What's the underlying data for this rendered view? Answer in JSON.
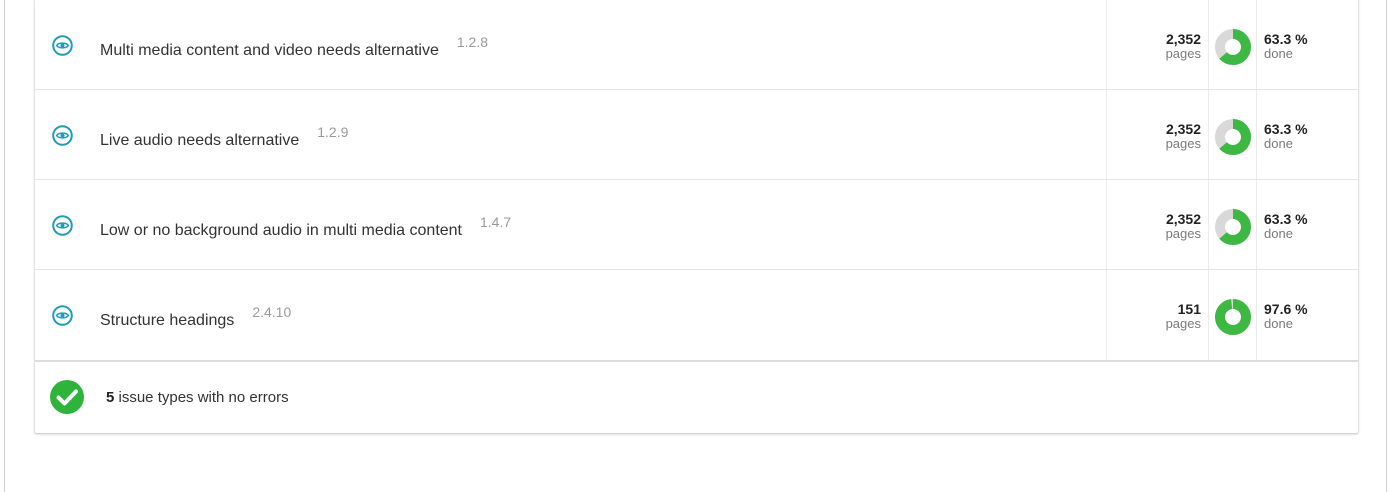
{
  "colors": {
    "accent_eye": "#1f9bb8",
    "done_green": "#3db843",
    "remaining_grey": "#d9d9d9",
    "check_green": "#2eb43a"
  },
  "issues": [
    {
      "title": "Multi media content and video needs alternative",
      "code": "1.2.8",
      "pages": "2,352",
      "pages_unit": "pages",
      "percent_label": "63.3 %",
      "percent_value": 63.3,
      "done_unit": "done",
      "icon": "eye-icon"
    },
    {
      "title": "Live audio needs alternative",
      "code": "1.2.9",
      "pages": "2,352",
      "pages_unit": "pages",
      "percent_label": "63.3 %",
      "percent_value": 63.3,
      "done_unit": "done",
      "icon": "eye-icon"
    },
    {
      "title": "Low or no background audio in multi media content",
      "code": "1.4.7",
      "pages": "2,352",
      "pages_unit": "pages",
      "percent_label": "63.3 %",
      "percent_value": 63.3,
      "done_unit": "done",
      "icon": "eye-icon"
    },
    {
      "title": "Structure headings",
      "code": "2.4.10",
      "pages": "151",
      "pages_unit": "pages",
      "percent_label": "97.6 %",
      "percent_value": 97.6,
      "done_unit": "done",
      "icon": "eye-icon"
    }
  ],
  "footer": {
    "count": "5",
    "text": " issue types with no errors",
    "icon": "check-circle-icon"
  }
}
